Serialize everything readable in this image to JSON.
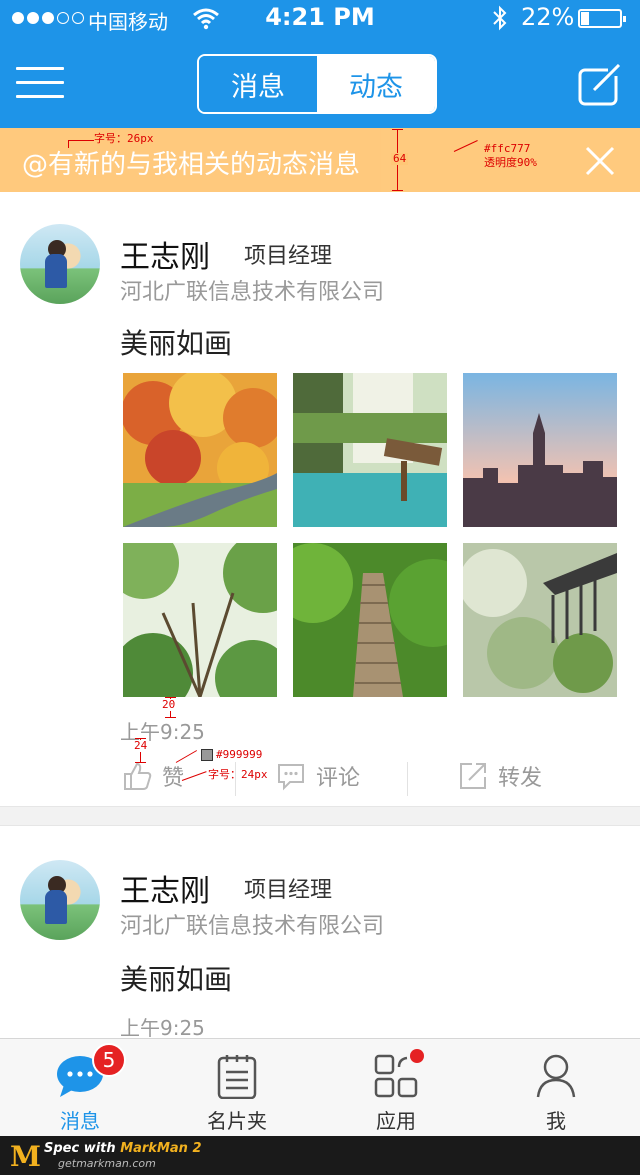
{
  "status_bar": {
    "carrier": "中国移动",
    "time": "4:21 PM",
    "battery": "22%",
    "battery_fraction": 0.22,
    "icons": [
      "signal-dots",
      "wifi-icon",
      "bluetooth-icon",
      "battery-icon"
    ]
  },
  "nav": {
    "tabs": [
      {
        "label": "消息",
        "active": true
      },
      {
        "label": "动态",
        "active": false
      }
    ],
    "icons": [
      "menu-icon",
      "compose-icon"
    ]
  },
  "notice": {
    "text": "@有新的与我相关的动态消息",
    "background": "#ffc777",
    "close_icon": "close-icon"
  },
  "annotations": {
    "font_26": "字号：26px",
    "height_64": "64",
    "color_ffc777": "#ffc777",
    "opacity": "透明度90%",
    "gap_20": "20",
    "gap_24": "24",
    "color_999999": "#999999",
    "font_24": "字号：24px"
  },
  "posts": [
    {
      "name": "王志刚",
      "role": "项目经理",
      "company": "河北广联信息技术有限公司",
      "content": "美丽如画",
      "photos": [
        "autumn-forest-road",
        "forest-waterfall-sign",
        "city-skyline-sunset",
        "tree-canopy",
        "forest-stone-steps",
        "garden-railing-bokeh"
      ],
      "time": "上午9:25",
      "actions": {
        "like": "赞",
        "comment": "评论",
        "share": "转发"
      }
    },
    {
      "name": "王志刚",
      "role": "项目经理",
      "company": "河北广联信息技术有限公司",
      "content": "美丽如画",
      "time": "上午9:25"
    }
  ],
  "tabbar": {
    "items": [
      {
        "label": "消息",
        "icon": "chat-bubble-icon",
        "active": true,
        "badge": "5"
      },
      {
        "label": "名片夹",
        "icon": "clipboard-icon",
        "active": false
      },
      {
        "label": "应用",
        "icon": "apps-grid-icon",
        "active": false,
        "dot": true
      },
      {
        "label": "我",
        "icon": "person-icon",
        "active": false
      }
    ]
  },
  "colors": {
    "brand": "#1e94e8",
    "notice": "#ffc777",
    "meta_gray": "#999999",
    "badge": "#e52223"
  },
  "markman": {
    "line1_prefix": "Spec with ",
    "line1_brand": "MarkMan 2",
    "line2": "getmarkman.com",
    "logo": "M"
  }
}
